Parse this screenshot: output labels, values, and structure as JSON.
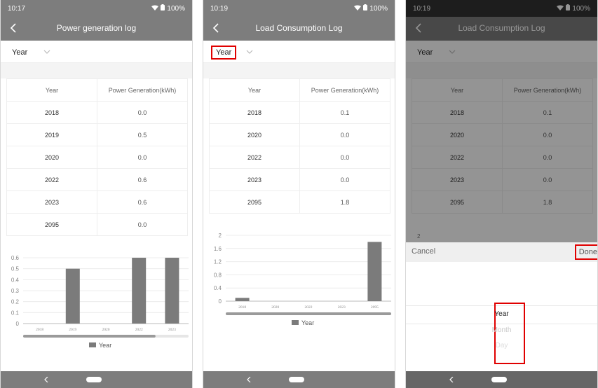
{
  "colors": {
    "bar": "#7b7b7b",
    "header": "#7d7d7d",
    "highlight": "#e00000"
  },
  "icons": {
    "back": "chevron-left-icon",
    "dropdown": "chevron-down-icon",
    "wifi": "wifi-icon",
    "battery": "battery-icon",
    "fan": "fan-icon",
    "nav_back": "nav-back-icon",
    "home": "home-pill-icon"
  },
  "screens": [
    {
      "status": {
        "time": "10:17",
        "battery": "100%"
      },
      "title": "Power generation log",
      "filter": {
        "selected": "Year"
      },
      "table": {
        "headers": [
          "Year",
          "Power Generation(kWh)"
        ],
        "rows": [
          {
            "year": "2018",
            "value": "0.0"
          },
          {
            "year": "2019",
            "value": "0.5"
          },
          {
            "year": "2020",
            "value": "0.0"
          },
          {
            "year": "2022",
            "value": "0.6"
          },
          {
            "year": "2023",
            "value": "0.6"
          },
          {
            "year": "2095",
            "value": "0.0"
          }
        ]
      },
      "legend": "Year"
    },
    {
      "status": {
        "time": "10:19",
        "battery": "100%"
      },
      "title": "Load Consumption Log",
      "filter": {
        "selected": "Year"
      },
      "table": {
        "headers": [
          "Year",
          "Power Generation(kWh)"
        ],
        "rows": [
          {
            "year": "2018",
            "value": "0.1"
          },
          {
            "year": "2020",
            "value": "0.0"
          },
          {
            "year": "2022",
            "value": "0.0"
          },
          {
            "year": "2023",
            "value": "0.0"
          },
          {
            "year": "2095",
            "value": "1.8"
          }
        ]
      },
      "legend": "Year"
    },
    {
      "status": {
        "time": "10:19",
        "battery": "100%"
      },
      "title": "Load Consumption Log",
      "filter": {
        "selected": "Year"
      },
      "table": {
        "headers": [
          "Year",
          "Power Generation(kWh)"
        ],
        "rows": [
          {
            "year": "2018",
            "value": "0.1"
          },
          {
            "year": "2020",
            "value": "0.0"
          },
          {
            "year": "2022",
            "value": "0.0"
          },
          {
            "year": "2023",
            "value": "0.0"
          },
          {
            "year": "2095",
            "value": "1.8"
          }
        ]
      },
      "chart_peek_label": "2",
      "picker": {
        "cancel": "Cancel",
        "done": "Done",
        "options": [
          "Year",
          "Month",
          "Day"
        ],
        "selected": "Year"
      }
    }
  ],
  "chart_data": [
    {
      "type": "bar",
      "categories": [
        "2018",
        "2019",
        "2020",
        "2022",
        "2023"
      ],
      "series": [
        {
          "name": "Year",
          "values": [
            0.0,
            0.5,
            0.0,
            0.6,
            0.6
          ]
        }
      ],
      "title": "",
      "xlabel": "",
      "ylabel": "",
      "ylim": [
        0,
        0.6
      ],
      "yticks": [
        "0",
        "0.1",
        "0.2",
        "0.3",
        "0.4",
        "0.5",
        "0.6"
      ],
      "grid": true,
      "legend": "bottom",
      "scrollbar_fraction": 0.8
    },
    {
      "type": "bar",
      "categories": [
        "2018",
        "2020",
        "2022",
        "2023",
        "2095"
      ],
      "series": [
        {
          "name": "Year",
          "values": [
            0.1,
            0.0,
            0.0,
            0.0,
            1.8
          ]
        }
      ],
      "title": "",
      "xlabel": "",
      "ylabel": "",
      "ylim": [
        0,
        2
      ],
      "yticks": [
        "0",
        "0.4",
        "0.8",
        "1.2",
        "1.6",
        "2"
      ],
      "grid": true,
      "legend": "bottom",
      "scrollbar_fraction": 1.0
    }
  ]
}
